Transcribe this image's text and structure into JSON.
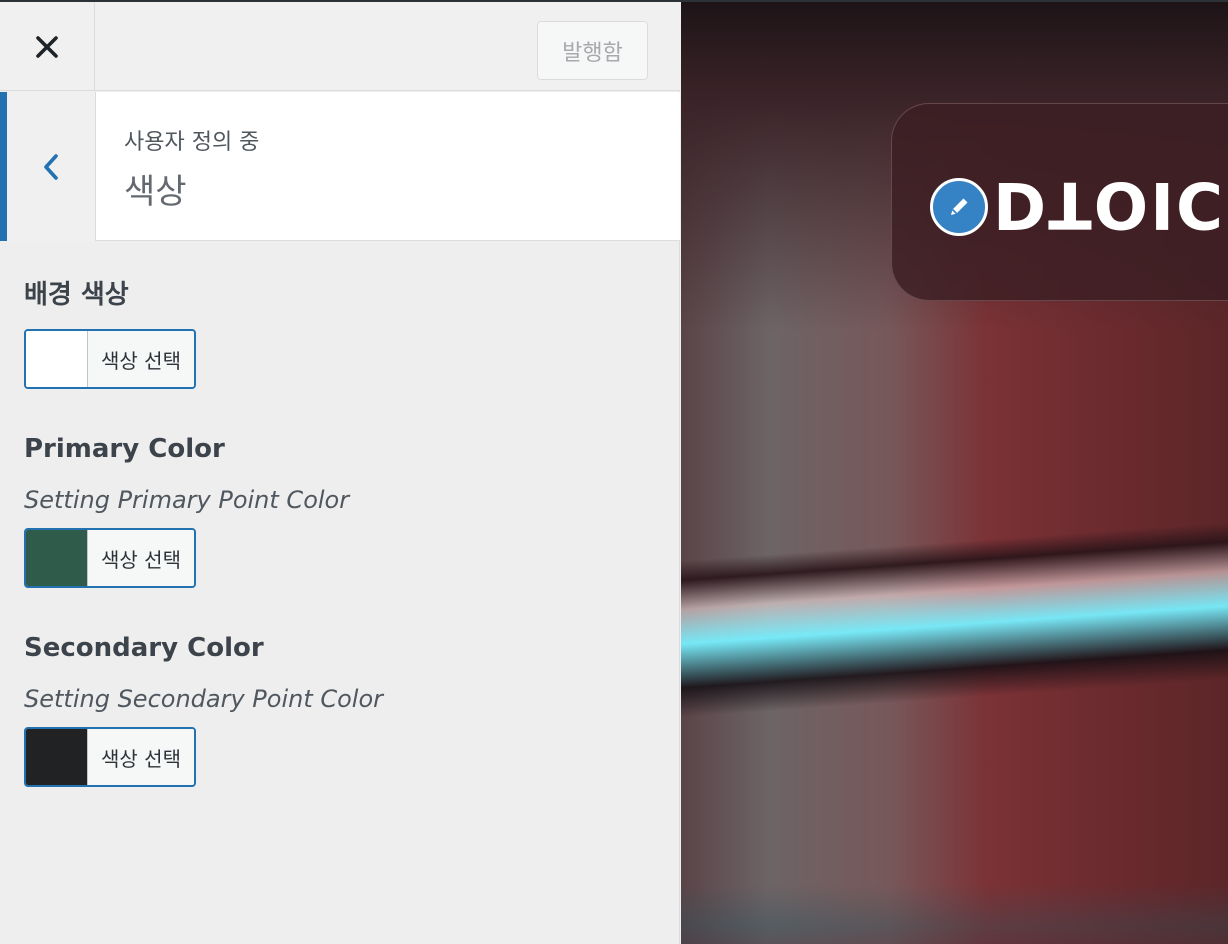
{
  "header": {
    "close_icon": "close-icon",
    "publish_label": "발행함"
  },
  "section": {
    "back_icon": "chevron-left-icon",
    "breadcrumb": "사용자 정의 중",
    "title": "색상"
  },
  "controls": [
    {
      "title": "배경 색상",
      "description": "",
      "color": "#ffffff",
      "button_label": "색상 선택"
    },
    {
      "title": "Primary Color",
      "description": "Setting Primary Point Color",
      "color": "#2f5c4a",
      "button_label": "색상 선택"
    },
    {
      "title": "Secondary Color",
      "description": "Setting Secondary Point Color",
      "color": "#202224",
      "button_label": "색상 선택"
    }
  ],
  "preview": {
    "edit_icon": "pencil-icon",
    "logo_text": "DTOIC"
  },
  "colors": {
    "accent": "#2271b1",
    "edit_badge": "#3582c4"
  }
}
